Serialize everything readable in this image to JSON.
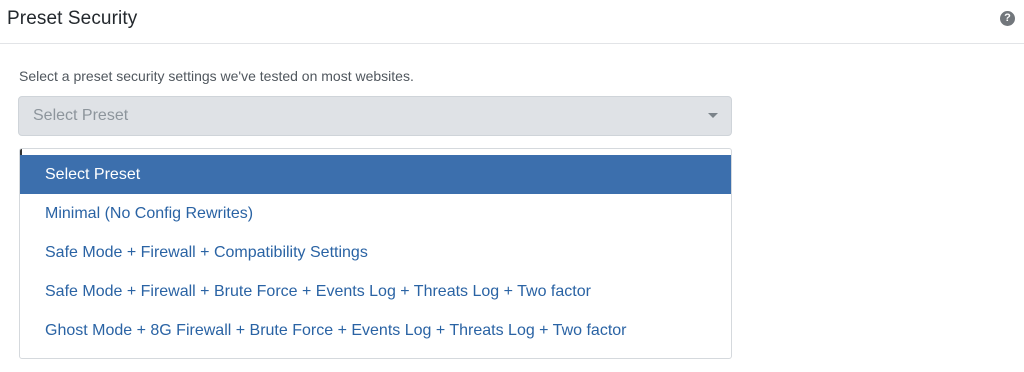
{
  "header": {
    "title": "Preset Security",
    "help_icon": "question-circle-icon",
    "help_glyph": "?"
  },
  "description": "Select a preset security settings we've tested on most websites.",
  "select": {
    "value": "Select Preset",
    "caret_icon": "chevron-down-icon"
  },
  "dropdown": {
    "options": [
      {
        "label": "Select Preset",
        "selected": true
      },
      {
        "label": "Minimal (No Config Rewrites)",
        "selected": false
      },
      {
        "label": "Safe Mode + Firewall + Compatibility Settings",
        "selected": false
      },
      {
        "label": "Safe Mode + Firewall + Brute Force + Events Log + Threats Log + Two factor",
        "selected": false
      },
      {
        "label": "Ghost Mode + 8G Firewall + Brute Force + Events Log + Threats Log + Two factor",
        "selected": false
      }
    ]
  },
  "colors": {
    "highlight": "#3c6fad",
    "option_text": "#2a63a4",
    "select_bg": "#dfe2e6"
  }
}
